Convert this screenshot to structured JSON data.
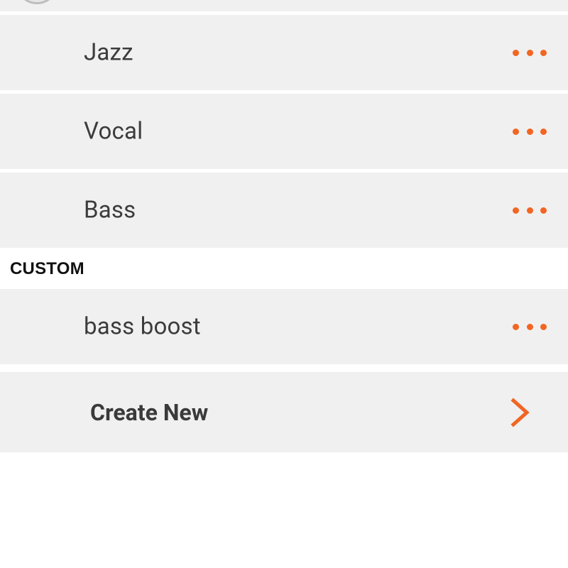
{
  "presets": {
    "items": [
      {
        "label": "Jazz",
        "more_icon": "more-horizontal-icon"
      },
      {
        "label": "Vocal",
        "more_icon": "more-horizontal-icon"
      },
      {
        "label": "Bass",
        "more_icon": "more-horizontal-icon"
      }
    ]
  },
  "custom": {
    "header": "CUSTOM",
    "items": [
      {
        "label": "bass boost",
        "more_icon": "more-horizontal-icon"
      }
    ]
  },
  "create_new": {
    "label": "Create New",
    "icon": "chevron-right-icon"
  },
  "colors": {
    "accent": "#f26522",
    "row_background": "#f0f0f0",
    "text": "#3c3c3c",
    "header_text": "#111111",
    "page_background": "#ffffff"
  }
}
